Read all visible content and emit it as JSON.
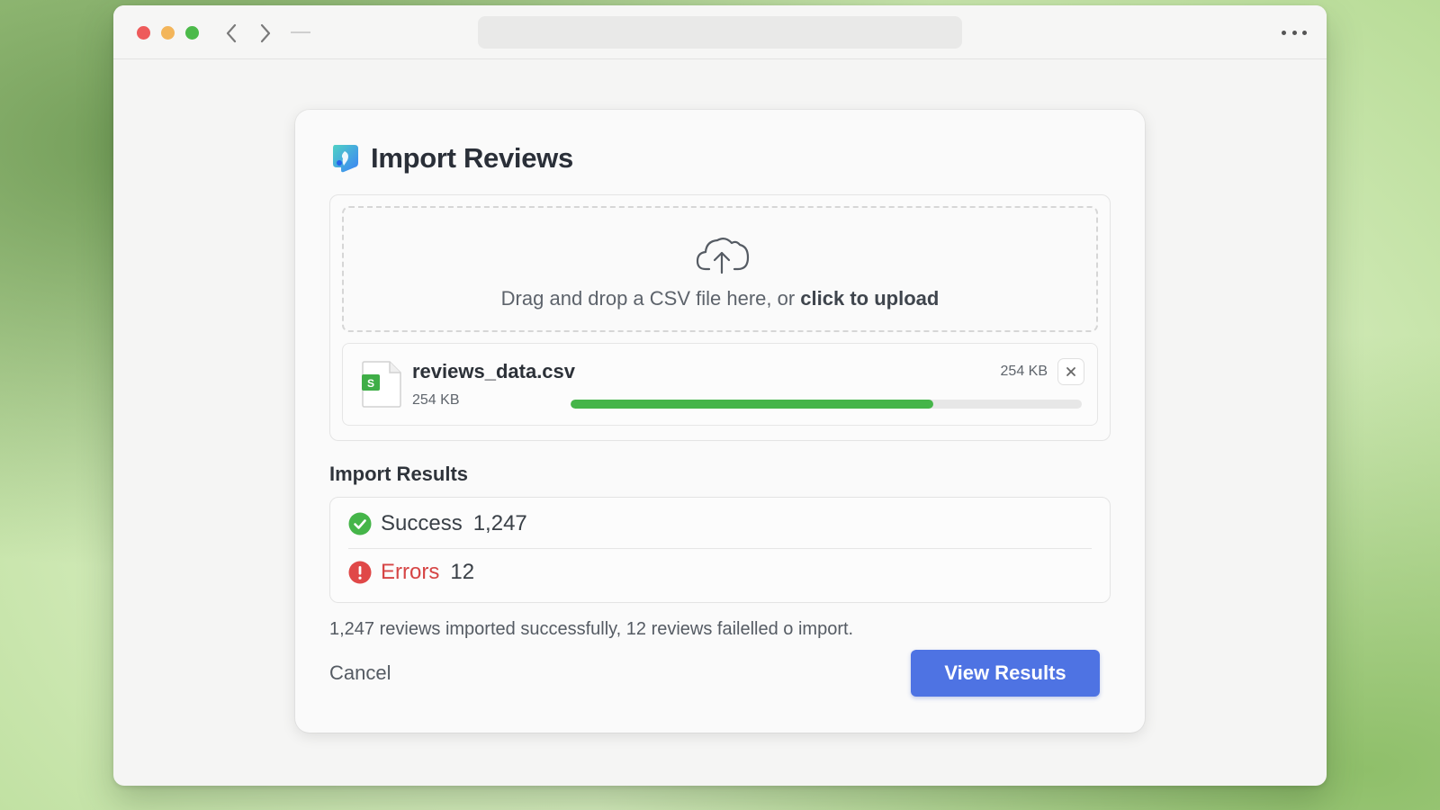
{
  "window": {
    "controls": [
      "close",
      "minimize",
      "zoom"
    ],
    "address": ""
  },
  "dialog": {
    "title": "Import Reviews",
    "icon": "app-icon",
    "dropzone": {
      "text": "Drag and drop a CSV file here, or ",
      "link": "click to upload",
      "icon": "cloud-upload-icon"
    },
    "file": {
      "name": "reviews_data.csv",
      "size": "254 KB",
      "size_right": "254 KB",
      "badge": "S",
      "progress": 0.71
    },
    "results": {
      "title": "Import Results",
      "success_label": "Success",
      "success_count": "1,247",
      "errors_label": "Errors",
      "errors_count": "12"
    },
    "summary": "1,247 reviews imported successfully, 12 reviews failelled o import.",
    "cancel_label": "Cancel",
    "view_label": "View Results"
  },
  "colors": {
    "accent": "#4e73e3",
    "success": "#45b549",
    "error": "#d64545"
  }
}
